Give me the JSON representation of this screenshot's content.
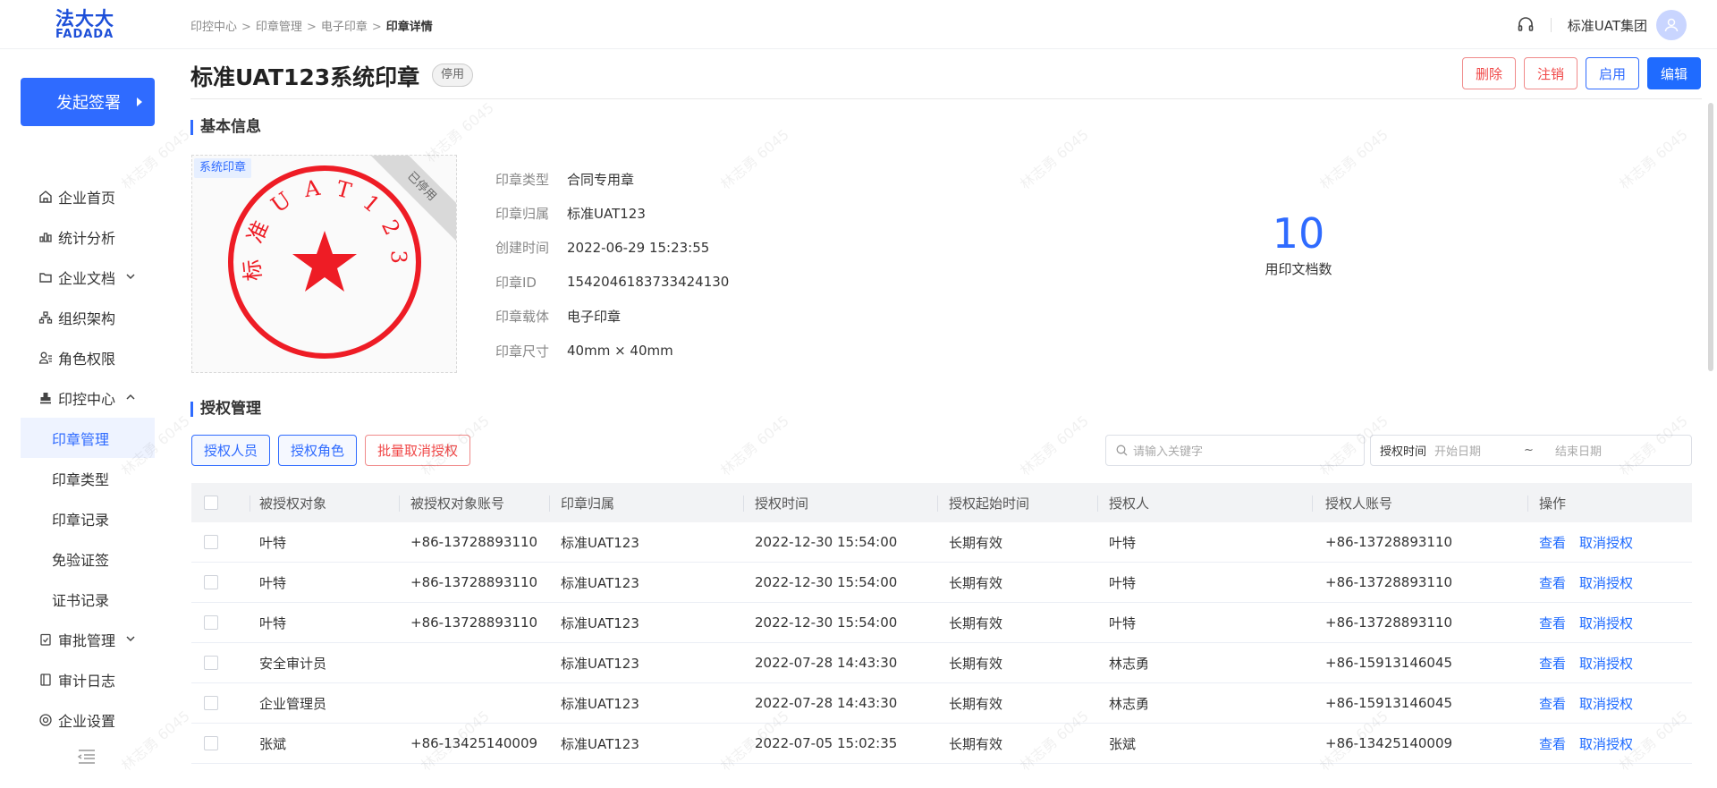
{
  "logo": {
    "cn": "法大大",
    "en": "FADADA"
  },
  "breadcrumb": [
    "印控中心",
    "印章管理",
    "电子印章",
    "印章详情"
  ],
  "header": {
    "company": "标准UAT集团"
  },
  "sidebar": {
    "start_button": "发起签署",
    "items": [
      {
        "label": "企业首页",
        "icon": "home-icon"
      },
      {
        "label": "统计分析",
        "icon": "chart-icon"
      },
      {
        "label": "企业文档",
        "icon": "folder-icon",
        "expand": "down"
      },
      {
        "label": "组织架构",
        "icon": "org-icon"
      },
      {
        "label": "角色权限",
        "icon": "user-role-icon"
      },
      {
        "label": "印控中心",
        "icon": "stamp-icon",
        "expand": "up"
      }
    ],
    "sub_items": [
      "印章管理",
      "印章类型",
      "印章记录",
      "免验证签",
      "证书记录"
    ],
    "items_after": [
      {
        "label": "审批管理",
        "icon": "approval-icon",
        "expand": "down"
      },
      {
        "label": "审计日志",
        "icon": "log-icon"
      },
      {
        "label": "企业设置",
        "icon": "settings-icon"
      }
    ]
  },
  "page": {
    "title": "标准UAT123系统印章",
    "status": "停用",
    "actions": {
      "delete": "删除",
      "cancel": "注销",
      "enable": "启用",
      "edit": "编辑"
    }
  },
  "basic_info": {
    "section_title": "基本信息",
    "seal_tag": "系统印章",
    "seal_ribbon": "已停用",
    "seal_text": "标 准 U A T 1 2 3",
    "fields": [
      {
        "label": "印章类型",
        "value": "合同专用章"
      },
      {
        "label": "印章归属",
        "value": "标准UAT123"
      },
      {
        "label": "创建时间",
        "value": "2022-06-29 15:23:55"
      },
      {
        "label": "印章ID",
        "value": "1542046183733424130"
      },
      {
        "label": "印章载体",
        "value": "电子印章"
      },
      {
        "label": "印章尺寸",
        "value": "40mm × 40mm"
      }
    ],
    "stat": {
      "value": "10",
      "label": "用印文档数"
    }
  },
  "auth": {
    "section_title": "授权管理",
    "buttons": {
      "auth_user": "授权人员",
      "auth_role": "授权角色",
      "batch_cancel": "批量取消授权"
    },
    "search_placeholder": "请输入关键字",
    "date_filter": {
      "label": "授权时间",
      "start": "开始日期",
      "sep": "~",
      "end": "结束日期"
    },
    "columns": [
      "被授权对象",
      "被授权对象账号",
      "印章归属",
      "授权时间",
      "授权起始时间",
      "授权人",
      "授权人账号",
      "操作"
    ],
    "rows": [
      {
        "target": "叶特",
        "account": "+86-13728893110",
        "owner": "标准UAT123",
        "time": "2022-12-30 15:54:00",
        "start": "长期有效",
        "grantor": "叶特",
        "grantor_account": "+86-13728893110",
        "view": "查看",
        "cancel": "取消授权"
      },
      {
        "target": "叶特",
        "account": "+86-13728893110",
        "owner": "标准UAT123",
        "time": "2022-12-30 15:54:00",
        "start": "长期有效",
        "grantor": "叶特",
        "grantor_account": "+86-13728893110",
        "view": "查看",
        "cancel": "取消授权"
      },
      {
        "target": "叶特",
        "account": "+86-13728893110",
        "owner": "标准UAT123",
        "time": "2022-12-30 15:54:00",
        "start": "长期有效",
        "grantor": "叶特",
        "grantor_account": "+86-13728893110",
        "view": "查看",
        "cancel": "取消授权"
      },
      {
        "target": "安全审计员",
        "account": "",
        "owner": "标准UAT123",
        "time": "2022-07-28 14:43:30",
        "start": "长期有效",
        "grantor": "林志勇",
        "grantor_account": "+86-15913146045",
        "view": "查看",
        "cancel": "取消授权"
      },
      {
        "target": "企业管理员",
        "account": "",
        "owner": "标准UAT123",
        "time": "2022-07-28 14:43:30",
        "start": "长期有效",
        "grantor": "林志勇",
        "grantor_account": "+86-15913146045",
        "view": "查看",
        "cancel": "取消授权"
      },
      {
        "target": "张斌",
        "account": "+86-13425140009",
        "owner": "标准UAT123",
        "time": "2022-07-05 15:02:35",
        "start": "长期有效",
        "grantor": "张斌",
        "grantor_account": "+86-13425140009",
        "view": "查看",
        "cancel": "取消授权"
      }
    ]
  },
  "watermark_text": "林志勇 6045",
  "colors": {
    "accent": "#2f6bff",
    "danger": "#f04848",
    "seal": "#ee1c25"
  }
}
